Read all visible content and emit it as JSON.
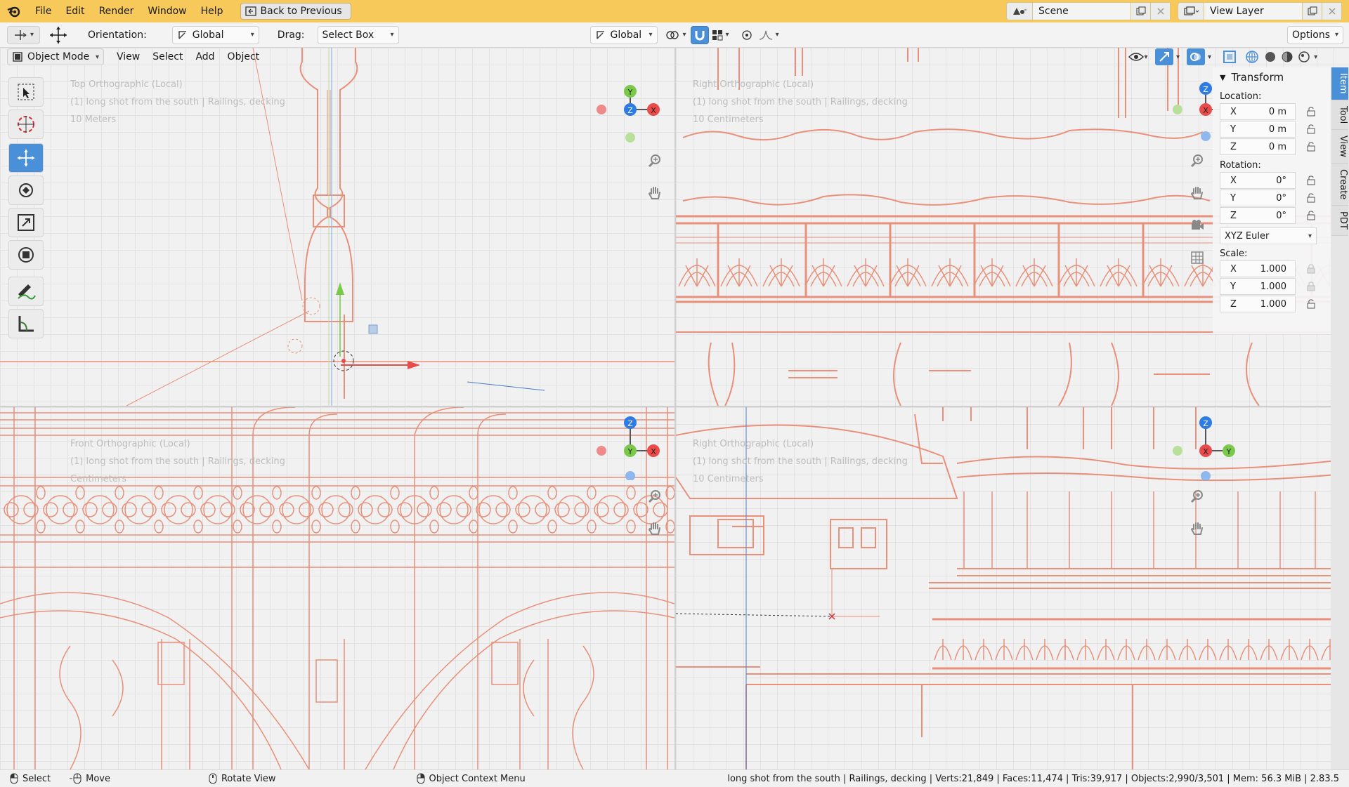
{
  "topbar": {
    "menus": [
      "File",
      "Edit",
      "Render",
      "Window",
      "Help"
    ],
    "back_button": "Back to Previous",
    "scene": "Scene",
    "view_layer": "View Layer"
  },
  "header": {
    "orientation_label": "Orientation:",
    "orientation_value": "Global",
    "drag_label": "Drag:",
    "drag_value": "Select Box",
    "transform_orientation": "Global",
    "options_label": "Options"
  },
  "viewport_menu": {
    "mode": "Object Mode",
    "items": [
      "View",
      "Select",
      "Add",
      "Object"
    ]
  },
  "viewports": {
    "top_left": {
      "line1": "Top Orthographic (Local)",
      "line2": "(1) long shot from the south | Railings, decking",
      "line3": "10 Meters"
    },
    "top_right": {
      "line1": "Right Orthographic (Local)",
      "line2": "(1) long shot from the south | Railings, decking",
      "line3": "10 Centimeters"
    },
    "bottom_left": {
      "line1": "Front Orthographic (Local)",
      "line2": "(1) long shot from the south | Railings, decking",
      "line3": "Centimeters"
    },
    "bottom_right": {
      "line1": "Right Orthographic (Local)",
      "line2": "(1) long shot from the south | Railings, decking",
      "line3": "10 Centimeters"
    }
  },
  "gizmo_labels": {
    "x": "X",
    "y": "Y",
    "z": "Z"
  },
  "n_panel": {
    "title": "Transform",
    "location_label": "Location:",
    "location": [
      {
        "axis": "X",
        "value": "0 m"
      },
      {
        "axis": "Y",
        "value": "0 m"
      },
      {
        "axis": "Z",
        "value": "0 m"
      }
    ],
    "rotation_label": "Rotation:",
    "rotation": [
      {
        "axis": "X",
        "value": "0°"
      },
      {
        "axis": "Y",
        "value": "0°"
      },
      {
        "axis": "Z",
        "value": "0°"
      }
    ],
    "rotation_mode": "XYZ Euler",
    "scale_label": "Scale:",
    "scale": [
      {
        "axis": "X",
        "value": "1.000"
      },
      {
        "axis": "Y",
        "value": "1.000"
      },
      {
        "axis": "Z",
        "value": "1.000"
      }
    ]
  },
  "side_tabs": [
    "Item",
    "Tool",
    "View",
    "Create",
    "PDT"
  ],
  "statusbar": {
    "select": "Select",
    "move": "Move",
    "rotate_view": "Rotate View",
    "context_menu": "Object Context Menu",
    "stats": "long shot from the south | Railings, decking | Verts:21,849 | Faces:11,474 | Tris:39,917 | Objects:2,990/3,501 | Mem: 56.3 MiB | 2.83.5"
  },
  "colors": {
    "topbar": "#f7c85a",
    "accent": "#4a90d9",
    "wire": "#e8907a",
    "axis_x": "#e94b4b",
    "axis_y": "#7ac94a",
    "axis_z": "#2f7be6"
  }
}
